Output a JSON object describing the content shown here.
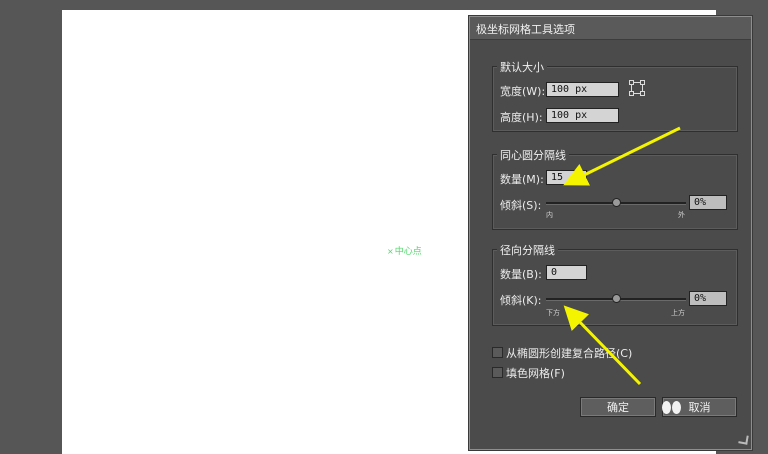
{
  "canvas": {
    "center_label": "中心点",
    "center_marker": "×"
  },
  "dialog": {
    "title": "极坐标网格工具选项",
    "default_size": {
      "legend": "默认大小",
      "width_label": "宽度(W):",
      "width_value": "100 px",
      "height_label": "高度(H):",
      "height_value": "100 px",
      "anchor_icon": "reference-point-icon"
    },
    "concentric": {
      "legend": "同心圆分隔线",
      "count_label": "数量(M):",
      "count_value": "15",
      "skew_label": "倾斜(S):",
      "skew_value": "0%",
      "skew_level": 0.5,
      "min_label": "内",
      "max_label": "外"
    },
    "radial": {
      "legend": "径向分隔线",
      "count_label": "数量(B):",
      "count_value": "0",
      "skew_label": "倾斜(K):",
      "skew_value": "0%",
      "skew_level": 0.5,
      "min_label": "下方",
      "max_label": "上方"
    },
    "options": {
      "compound_path": {
        "label": "从椭圆形创建复合路径(C)",
        "checked": false
      },
      "fill_grid": {
        "label": "填色网格(F)",
        "checked": false
      }
    },
    "buttons": {
      "ok": "确定",
      "cancel": "取消"
    }
  },
  "annotation_color": "#f4f400"
}
